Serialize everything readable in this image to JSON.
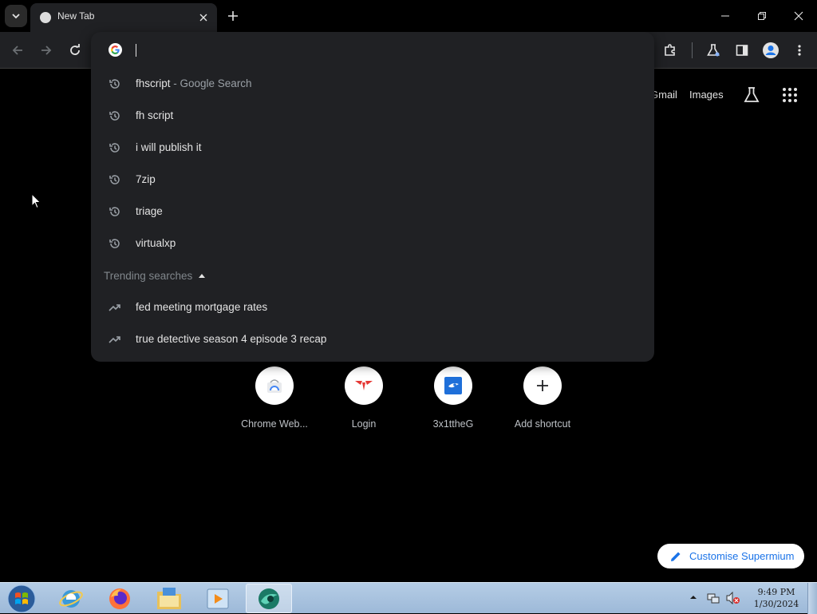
{
  "tab": {
    "title": "New Tab"
  },
  "omnibox": {
    "input_value": "",
    "suggestions": [
      {
        "text": "fhscript",
        "description": " - Google Search",
        "icon": "history-icon"
      },
      {
        "text": "fh script",
        "description": "",
        "icon": "history-icon"
      },
      {
        "text": "i will publish it",
        "description": "",
        "icon": "history-icon"
      },
      {
        "text": "7zip",
        "description": "",
        "icon": "history-icon"
      },
      {
        "text": "triage",
        "description": "",
        "icon": "history-icon"
      },
      {
        "text": "virtualxp",
        "description": "",
        "icon": "history-icon"
      }
    ],
    "trending_header": "Trending searches",
    "trending": [
      {
        "text": "fed meeting mortgage rates",
        "icon": "trending-icon"
      },
      {
        "text": "true detective season 4 episode 3 recap",
        "icon": "trending-icon"
      }
    ]
  },
  "ntp": {
    "gmail": "Gmail",
    "images": "Images",
    "shortcuts": [
      {
        "label": "Chrome Web...",
        "icon": "chrome-web-store-icon"
      },
      {
        "label": "Login",
        "icon": "login-site-icon"
      },
      {
        "label": "3x1ttheG",
        "icon": "3x1ttheg-site-icon"
      },
      {
        "label": "Add shortcut",
        "icon": "plus-icon"
      }
    ],
    "customise": "Customise Supermium"
  },
  "taskbar": {
    "time": "9:49 PM",
    "date": "1/30/2024"
  },
  "colors": {
    "background": "#000000",
    "omnibox_bg": "#202124",
    "accent_blue": "#1a73e8",
    "taskbar": "#a9c4e0"
  }
}
